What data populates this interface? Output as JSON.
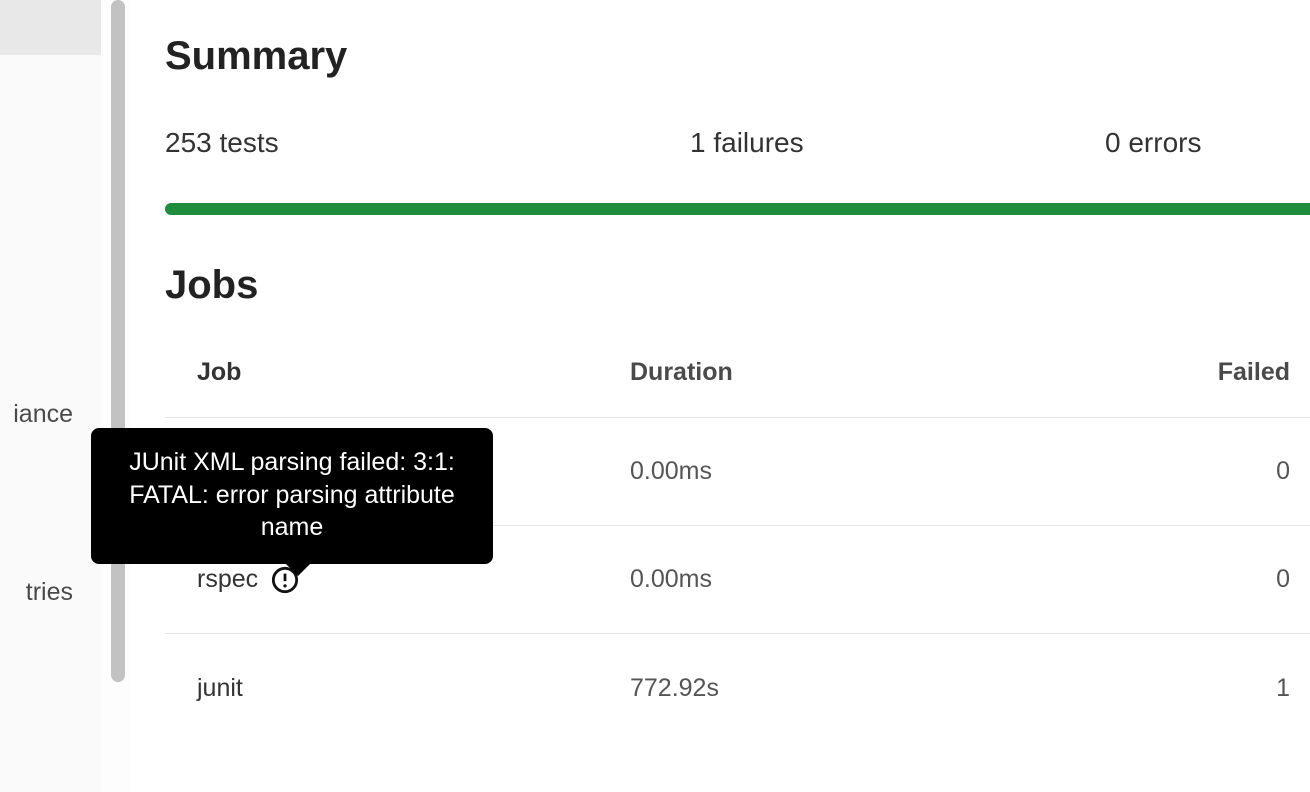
{
  "sidebar": {
    "items": [
      {
        "label": "iance"
      },
      {
        "label": "tries"
      }
    ]
  },
  "summary": {
    "heading": "Summary",
    "tests": "253 tests",
    "failures": "1 failures",
    "errors": "0 errors"
  },
  "jobs": {
    "heading": "Jobs",
    "columns": {
      "job": "Job",
      "duration": "Duration",
      "failed": "Failed"
    },
    "rows": [
      {
        "name": "",
        "duration": "0.00ms",
        "failed": "0",
        "has_error_icon": false
      },
      {
        "name": "rspec",
        "duration": "0.00ms",
        "failed": "0",
        "has_error_icon": true
      },
      {
        "name": "junit",
        "duration": "772.92s",
        "failed": "1",
        "has_error_icon": false
      }
    ]
  },
  "tooltip": {
    "text": "JUnit XML parsing failed: 3:1: FATAL: error parsing attribute name"
  },
  "colors": {
    "progress_green": "#1e8e3e",
    "tooltip_bg": "#000000"
  }
}
